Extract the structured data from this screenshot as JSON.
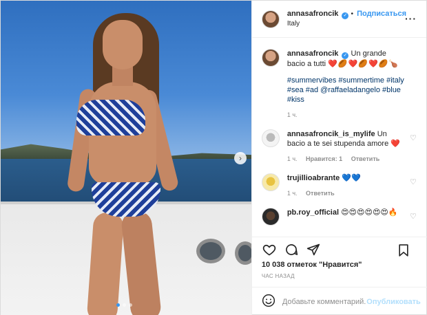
{
  "header": {
    "username": "annasafroncik",
    "follow_label": "Подписаться",
    "location": "Italy",
    "dot": "•"
  },
  "caption": {
    "username": "annasafroncik",
    "text": "Un grande bacio a tutti",
    "emojis": "❤️🏉❤️🏉❤️🏉🍗",
    "hashtags": "#summervibes #summertime #italy #sea #ad @raffaeladangelo #blue #kiss",
    "time": "1 ч."
  },
  "comments": [
    {
      "username": "annasafroncik_is_mylife",
      "text": "Un bacio a te sei stupenda amore",
      "emoji": "❤️",
      "time": "1 ч.",
      "likes": "Нравится: 1",
      "reply": "Ответить"
    },
    {
      "username": "trujillioabrante",
      "text": "",
      "emoji": "💙💙",
      "time": "1 ч.",
      "reply": "Ответить"
    },
    {
      "username": "pb.roy_official",
      "text": "",
      "emoji": "😍😍😍😍😍😍🔥"
    }
  ],
  "actions": {
    "like_icon": "heart-icon",
    "comment_icon": "comment-icon",
    "share_icon": "share-icon",
    "save_icon": "bookmark-icon"
  },
  "likes_text": "10 038 отметок \"Нравится\"",
  "time_ago": "ЧАС НАЗАД",
  "add_comment": {
    "placeholder": "Добавьте комментарий...",
    "publish_label": "Опубликовать"
  },
  "colors": {
    "link": "#3897f0",
    "publish_disabled": "#b2dffc",
    "muted": "#8e8e8e",
    "text": "#262626"
  },
  "carousel": {
    "slides": 3,
    "active": 1
  }
}
